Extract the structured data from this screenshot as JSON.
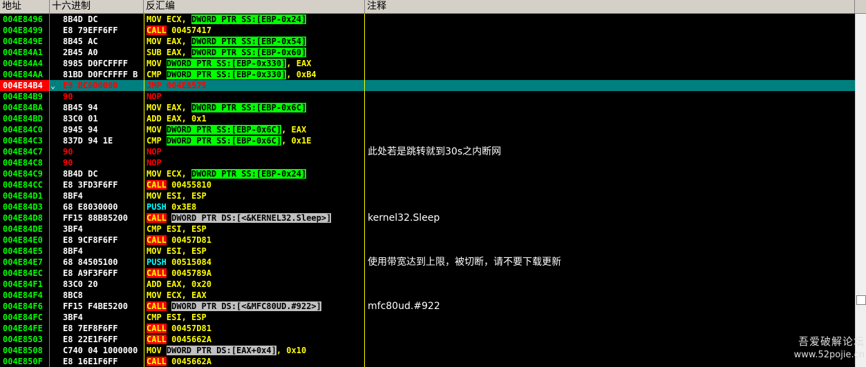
{
  "header": {
    "address": "地址",
    "hex": "十六进制",
    "disasm": "反汇编",
    "comment": "注释"
  },
  "rows": [
    {
      "addr": "004E8496",
      "hex": "8B4D DC",
      "parts": [
        {
          "t": "MOV ",
          "c": "mn"
        },
        {
          "t": "ECX, ",
          "c": "op"
        },
        {
          "t": "DWORD PTR SS:[EBP-0x24]",
          "c": "mem"
        }
      ],
      "comment": ""
    },
    {
      "addr": "004E8499",
      "hex": "E8 79EFF6FF",
      "parts": [
        {
          "t": "CALL",
          "c": "mn call"
        },
        {
          "t": " 00457417",
          "c": "op"
        }
      ],
      "comment": ""
    },
    {
      "addr": "004E849E",
      "hex": "8B45 AC",
      "parts": [
        {
          "t": "MOV ",
          "c": "mn"
        },
        {
          "t": "EAX, ",
          "c": "op"
        },
        {
          "t": "DWORD PTR SS:[EBP-0x54]",
          "c": "mem"
        }
      ],
      "comment": ""
    },
    {
      "addr": "004E84A1",
      "hex": "2B45 A0",
      "parts": [
        {
          "t": "SUB ",
          "c": "mn"
        },
        {
          "t": "EAX, ",
          "c": "op"
        },
        {
          "t": "DWORD PTR SS:[EBP-0x60]",
          "c": "mem"
        }
      ],
      "comment": ""
    },
    {
      "addr": "004E84A4",
      "hex": "8985 D0FCFFFF",
      "parts": [
        {
          "t": "MOV ",
          "c": "mn"
        },
        {
          "t": "DWORD PTR SS:[EBP-0x330]",
          "c": "mem"
        },
        {
          "t": ", EAX",
          "c": "op"
        }
      ],
      "comment": ""
    },
    {
      "addr": "004E84AA",
      "hex": "81BD D0FCFFFF B",
      "parts": [
        {
          "t": "CMP ",
          "c": "mn"
        },
        {
          "t": "DWORD PTR SS:[EBP-0x330]",
          "c": "mem"
        },
        {
          "t": ", 0xB4",
          "c": "op"
        }
      ],
      "comment": ""
    },
    {
      "addr": "004E84B4",
      "hex": "E9 BC000000",
      "current": true,
      "mark": "⌄",
      "parts": [
        {
          "t": "JMP ",
          "c": "mn jmp"
        },
        {
          "t": "004E8575",
          "c": "op"
        }
      ],
      "comment": ""
    },
    {
      "addr": "004E84B9",
      "hex": "90",
      "hexRed": true,
      "parts": [
        {
          "t": "NOP",
          "c": "mn nop"
        }
      ],
      "comment": ""
    },
    {
      "addr": "004E84BA",
      "hex": "8B45 94",
      "parts": [
        {
          "t": "MOV ",
          "c": "mn"
        },
        {
          "t": "EAX, ",
          "c": "op"
        },
        {
          "t": "DWORD PTR SS:[EBP-0x6C]",
          "c": "mem"
        }
      ],
      "comment": ""
    },
    {
      "addr": "004E84BD",
      "hex": "83C0 01",
      "parts": [
        {
          "t": "ADD ",
          "c": "mn"
        },
        {
          "t": "EAX, 0x1",
          "c": "op"
        }
      ],
      "comment": ""
    },
    {
      "addr": "004E84C0",
      "hex": "8945 94",
      "parts": [
        {
          "t": "MOV ",
          "c": "mn"
        },
        {
          "t": "DWORD PTR SS:[EBP-0x6C]",
          "c": "mem"
        },
        {
          "t": ", EAX",
          "c": "op"
        }
      ],
      "comment": ""
    },
    {
      "addr": "004E84C3",
      "hex": "837D 94 1E",
      "parts": [
        {
          "t": "CMP ",
          "c": "mn"
        },
        {
          "t": "DWORD PTR SS:[EBP-0x6C]",
          "c": "mem"
        },
        {
          "t": ", 0x1E",
          "c": "op"
        }
      ],
      "comment": ""
    },
    {
      "addr": "004E84C7",
      "hex": "90",
      "hexRed": true,
      "parts": [
        {
          "t": "NOP",
          "c": "mn nop"
        }
      ],
      "comment": "此处若是跳转就到30s之内断网"
    },
    {
      "addr": "004E84C8",
      "hex": "90",
      "hexRed": true,
      "parts": [
        {
          "t": "NOP",
          "c": "mn nop"
        }
      ],
      "comment": ""
    },
    {
      "addr": "004E84C9",
      "hex": "8B4D DC",
      "parts": [
        {
          "t": "MOV ",
          "c": "mn"
        },
        {
          "t": "ECX, ",
          "c": "op"
        },
        {
          "t": "DWORD PTR SS:[EBP-0x24]",
          "c": "mem"
        }
      ],
      "comment": ""
    },
    {
      "addr": "004E84CC",
      "hex": "E8 3FD3F6FF",
      "parts": [
        {
          "t": "CALL",
          "c": "mn call"
        },
        {
          "t": " 00455810",
          "c": "op"
        }
      ],
      "comment": ""
    },
    {
      "addr": "004E84D1",
      "hex": "8BF4",
      "parts": [
        {
          "t": "MOV ",
          "c": "mn"
        },
        {
          "t": "ESI, ESP",
          "c": "op"
        }
      ],
      "comment": ""
    },
    {
      "addr": "004E84D3",
      "hex": "68 E8030000",
      "parts": [
        {
          "t": "PUSH",
          "c": "mn push"
        },
        {
          "t": " 0x3E8",
          "c": "op"
        }
      ],
      "comment": ""
    },
    {
      "addr": "004E84D8",
      "hex": "FF15 88B85200",
      "parts": [
        {
          "t": "CALL",
          "c": "mn call"
        },
        {
          "t": " ",
          "c": "op"
        },
        {
          "t": "DWORD PTR DS:[<&KERNEL32.Sleep>]",
          "c": "mem gray"
        }
      ],
      "comment": "kernel32.Sleep"
    },
    {
      "addr": "004E84DE",
      "hex": "3BF4",
      "parts": [
        {
          "t": "CMP ",
          "c": "mn"
        },
        {
          "t": "ESI, ESP",
          "c": "op"
        }
      ],
      "comment": ""
    },
    {
      "addr": "004E84E0",
      "hex": "E8 9CF8F6FF",
      "parts": [
        {
          "t": "CALL",
          "c": "mn call"
        },
        {
          "t": " 00457D81",
          "c": "op"
        }
      ],
      "comment": ""
    },
    {
      "addr": "004E84E5",
      "hex": "8BF4",
      "parts": [
        {
          "t": "MOV ",
          "c": "mn"
        },
        {
          "t": "ESI, ESP",
          "c": "op"
        }
      ],
      "comment": ""
    },
    {
      "addr": "004E84E7",
      "hex": "68 84505100",
      "parts": [
        {
          "t": "PUSH",
          "c": "mn push"
        },
        {
          "t": " 00515084",
          "c": "op"
        }
      ],
      "comment": "使用带宽达到上限，被切断，请不要下载更新"
    },
    {
      "addr": "004E84EC",
      "hex": "E8 A9F3F6FF",
      "parts": [
        {
          "t": "CALL",
          "c": "mn call"
        },
        {
          "t": " 0045789A",
          "c": "op"
        }
      ],
      "comment": ""
    },
    {
      "addr": "004E84F1",
      "hex": "83C0 20",
      "parts": [
        {
          "t": "ADD ",
          "c": "mn"
        },
        {
          "t": "EAX, 0x20",
          "c": "op"
        }
      ],
      "comment": ""
    },
    {
      "addr": "004E84F4",
      "hex": "8BC8",
      "parts": [
        {
          "t": "MOV ",
          "c": "mn"
        },
        {
          "t": "ECX, EAX",
          "c": "op"
        }
      ],
      "comment": ""
    },
    {
      "addr": "004E84F6",
      "hex": "FF15 F4BE5200",
      "parts": [
        {
          "t": "CALL",
          "c": "mn call"
        },
        {
          "t": " ",
          "c": "op"
        },
        {
          "t": "DWORD PTR DS:[<&MFC80UD.#922>]",
          "c": "mem gray"
        }
      ],
      "comment": "mfc80ud.#922"
    },
    {
      "addr": "004E84FC",
      "hex": "3BF4",
      "parts": [
        {
          "t": "CMP ",
          "c": "mn"
        },
        {
          "t": "ESI, ESP",
          "c": "op"
        }
      ],
      "comment": ""
    },
    {
      "addr": "004E84FE",
      "hex": "E8 7EF8F6FF",
      "parts": [
        {
          "t": "CALL",
          "c": "mn call"
        },
        {
          "t": " 00457D81",
          "c": "op"
        }
      ],
      "comment": ""
    },
    {
      "addr": "004E8503",
      "hex": "E8 22E1F6FF",
      "parts": [
        {
          "t": "CALL",
          "c": "mn call"
        },
        {
          "t": " 0045662A",
          "c": "op"
        }
      ],
      "comment": ""
    },
    {
      "addr": "004E8508",
      "hex": "C740 04 1000000",
      "parts": [
        {
          "t": "MOV ",
          "c": "mn"
        },
        {
          "t": "DWORD PTR DS:[EAX+0x4]",
          "c": "mem gray"
        },
        {
          "t": ", 0x10",
          "c": "op"
        }
      ],
      "comment": ""
    },
    {
      "addr": "004E850F",
      "hex": "E8 16E1F6FF",
      "parts": [
        {
          "t": "CALL",
          "c": "mn call"
        },
        {
          "t": " 0045662A",
          "c": "op"
        }
      ],
      "comment": ""
    }
  ],
  "scrollbar": {
    "position": 0.82
  },
  "watermark": {
    "line1": "吾爱破解论坛",
    "line2": "www.52pojie.cn"
  }
}
